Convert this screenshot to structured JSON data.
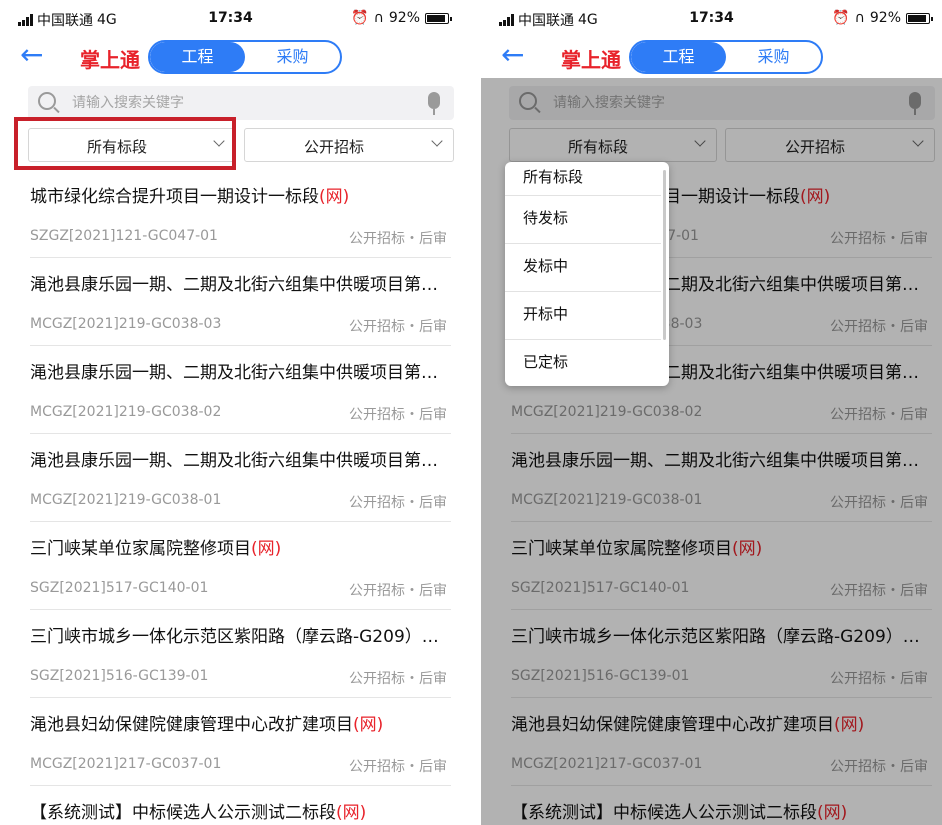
{
  "status": {
    "carrier": "中国联通",
    "network": "4G",
    "time": "17:34",
    "battery": "92%"
  },
  "header": {
    "title": "掌上通",
    "tabs": [
      {
        "label": "工程"
      },
      {
        "label": "采购"
      }
    ]
  },
  "search": {
    "placeholder": "请输入搜索关键字"
  },
  "filters": {
    "stage": "所有标段",
    "method": "公开招标"
  },
  "dropdown": {
    "options": [
      "所有标段",
      "待发标",
      "发标中",
      "开标中",
      "已定标"
    ]
  },
  "items": [
    {
      "title": "城市绿化综合提升项目一期设计一标段",
      "tag": "(网)",
      "code": "SZGZ[2021]121-GC047-01",
      "type": "公开招标・后审"
    },
    {
      "title": "渑池县康乐园一期、二期及北街六组集中供暖项目第…",
      "tag": "",
      "code": "MCGZ[2021]219-GC038-03",
      "type": "公开招标・后审"
    },
    {
      "title": "渑池县康乐园一期、二期及北街六组集中供暖项目第…",
      "tag": "",
      "code": "MCGZ[2021]219-GC038-02",
      "type": "公开招标・后审"
    },
    {
      "title": "渑池县康乐园一期、二期及北街六组集中供暖项目第…",
      "tag": "",
      "code": "MCGZ[2021]219-GC038-01",
      "type": "公开招标・后审"
    },
    {
      "title": "三门峡某单位家属院整修项目",
      "tag": "(网)",
      "code": "SGZ[2021]517-GC140-01",
      "type": "公开招标・后审"
    },
    {
      "title": "三门峡市城乡一体化示范区紫阳路（摩云路-G209）…",
      "tag": "",
      "code": "SGZ[2021]516-GC139-01",
      "type": "公开招标・后审"
    },
    {
      "title": "渑池县妇幼保健院健康管理中心改扩建项目",
      "tag": "(网)",
      "code": "MCGZ[2021]217-GC037-01",
      "type": "公开招标・后审"
    },
    {
      "title": "【系统测试】中标候选人公示测试二标段",
      "tag": "(网)",
      "code": "",
      "type": ""
    }
  ],
  "colors": {
    "accent": "#2e7cf6",
    "brand": "#e8232b",
    "highlight": "#c8202a"
  }
}
